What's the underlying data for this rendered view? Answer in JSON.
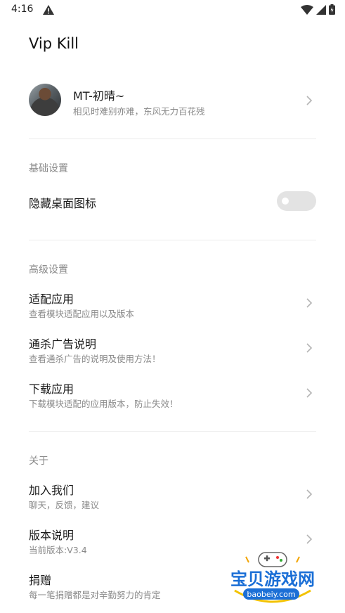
{
  "status_bar": {
    "time": "4:16"
  },
  "app": {
    "title": "Vip Kill"
  },
  "profile": {
    "name": "MT-初晴~",
    "motto": "相见时难别亦难，东风无力百花残"
  },
  "basic_settings": {
    "header": "基础设置",
    "hide_icon": {
      "label": "隐藏桌面图标",
      "enabled": false
    }
  },
  "advanced_settings": {
    "header": "高级设置",
    "items": [
      {
        "title": "适配应用",
        "subtitle": "查看模块适配应用以及版本"
      },
      {
        "title": "通杀广告说明",
        "subtitle": "查看通杀广告的说明及使用方法！"
      },
      {
        "title": "下载应用",
        "subtitle": "下载模块适配的应用版本，防止失效！"
      }
    ]
  },
  "about": {
    "header": "关于",
    "items": [
      {
        "title": "加入我们",
        "subtitle": "聊天，反馈，建议"
      },
      {
        "title": "版本说明",
        "subtitle": "当前版本:V3.4"
      },
      {
        "title": "捐赠",
        "subtitle": "每一笔捐赠都是对辛勤努力的肯定"
      }
    ]
  },
  "watermark": {
    "brand": "宝贝游戏网",
    "domain": "baobeiy.com"
  },
  "colors": {
    "primary_text": "#1a1a1a",
    "secondary_text": "#8a8a8a",
    "divider": "#ececec",
    "toggle_off": "#e3e3e3"
  }
}
